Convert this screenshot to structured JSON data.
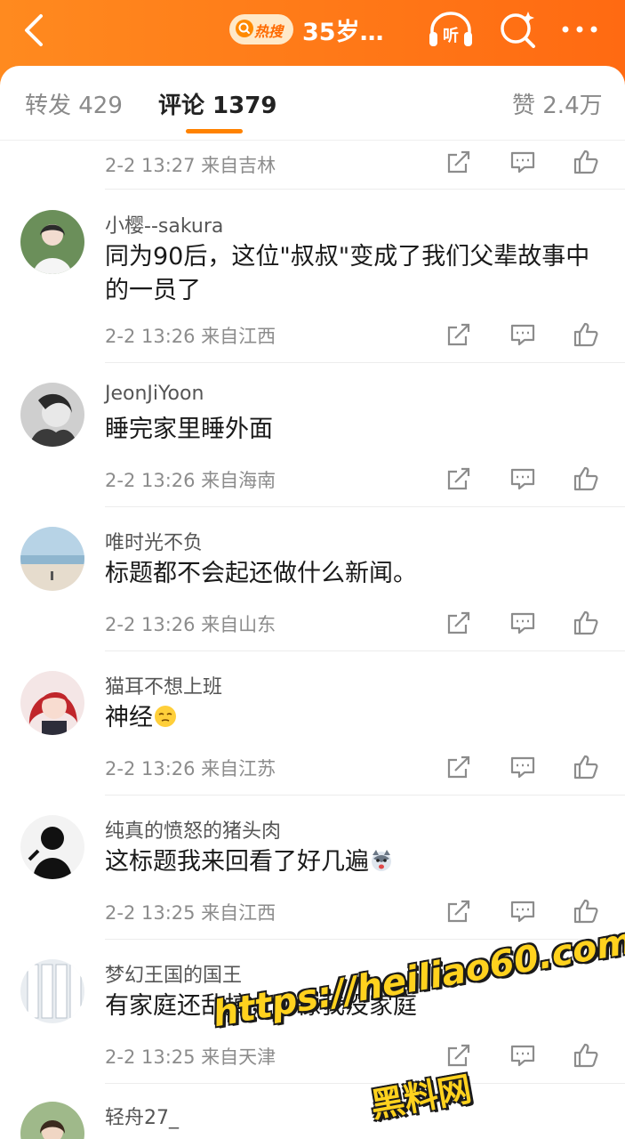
{
  "header": {
    "hot_tag": "热搜",
    "title": "35岁…",
    "listen_label": "听"
  },
  "tabs": [
    {
      "label": "转发 429"
    },
    {
      "label": "评论 1379"
    },
    {
      "label": "赞 2.4万"
    }
  ],
  "comments": [
    {
      "meta": "2-2 13:27 来自吉林"
    },
    {
      "user": "小樱--sakura",
      "text": "同为90后，这位\"叔叔\"变成了我们父辈故事中的一员了",
      "meta": "2-2 13:26 来自江西"
    },
    {
      "user": "JeonJiYoon",
      "text": "睡完家里睡外面",
      "meta": "2-2 13:26 来自海南"
    },
    {
      "user": "唯时光不负",
      "text": "标题都不会起还做什么新闻。",
      "meta": "2-2 13:26 来自山东"
    },
    {
      "user": "猫耳不想上班",
      "text": "神经",
      "meta": "2-2 13:26 来自江苏"
    },
    {
      "user": "纯真的愤怒的猪头肉",
      "text": "这标题我来回看了好几遍",
      "meta": "2-2 13:25 来自江西"
    },
    {
      "user": "梦幻王国的国王",
      "text": "有家庭还乱搞，不像我没家庭",
      "meta": "2-2 13:25 来自天津"
    },
    {
      "user": "轻舟27_"
    }
  ],
  "watermark": {
    "url": "https://heiliao60.com",
    "name": "黑料网"
  },
  "colors": {
    "accent": "#ff8200",
    "header_bg": "#ff7a18"
  },
  "icons": [
    "back-arrow-icon",
    "search-hot-icon",
    "listen-icon",
    "search-sparkle-icon",
    "more-icon",
    "share-icon",
    "comment-icon",
    "like-icon"
  ]
}
